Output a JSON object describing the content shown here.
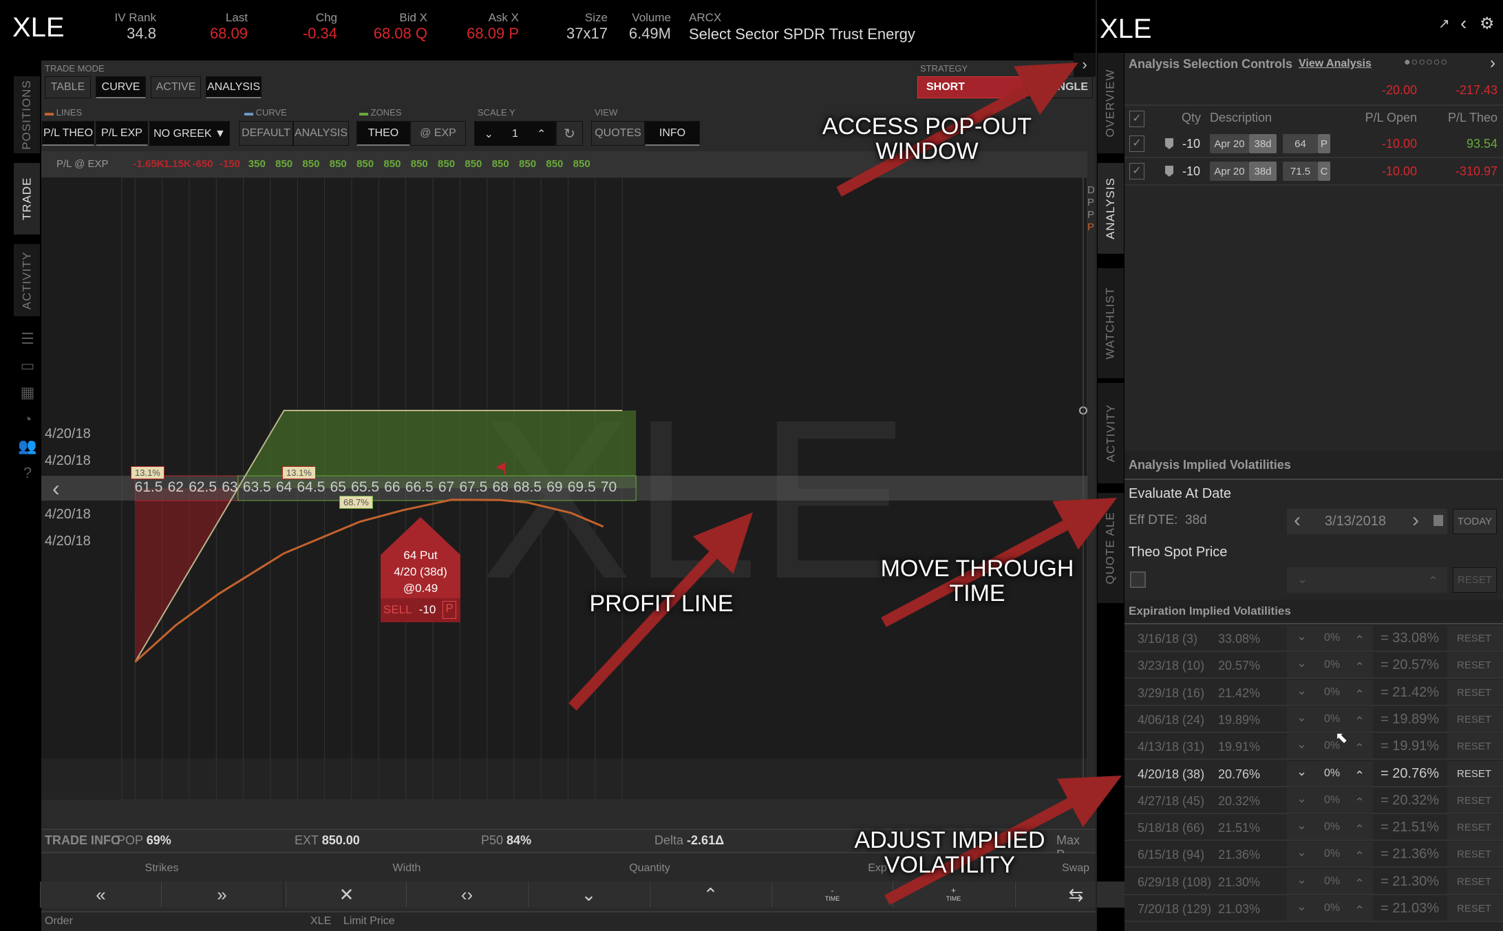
{
  "header": {
    "symbol": "XLE",
    "fields": [
      {
        "label": "IV Rank",
        "value": "34.8",
        "color": "#cccccc"
      },
      {
        "label": "Last",
        "value": "68.09",
        "color": "#d9262c"
      },
      {
        "label": "Chg",
        "value": "-0.34",
        "color": "#d9262c"
      },
      {
        "label": "Bid X",
        "value": "68.08 Q",
        "color": "#d9262c"
      },
      {
        "label": "Ask X",
        "value": "68.09 P",
        "color": "#d9262c"
      },
      {
        "label": "Size",
        "value": "37x17",
        "color": "#cccccc"
      },
      {
        "label": "Volume",
        "value": "6.49M",
        "color": "#cccccc"
      }
    ],
    "exchange": "ARCX",
    "description": "Select Sector SPDR Trust Energy"
  },
  "left_tabs": [
    "POSITIONS",
    "TRADE",
    "ACTIVITY"
  ],
  "left_icons": [
    "list-icon",
    "tv-icon",
    "calendar-icon",
    "gauge-icon",
    "people-icon",
    "help-icon"
  ],
  "trade_mode": {
    "label": "TRADE MODE",
    "tabs": [
      "TABLE",
      "CURVE",
      "ACTIVE",
      "ANALYSIS"
    ],
    "strategy_label": "STRATEGY",
    "strategy_value": "SHORT",
    "strategy_suffix": "NGLE"
  },
  "toolbar": {
    "lines": {
      "label": "LINES",
      "buttons": [
        "P/L THEO",
        "P/L EXP"
      ],
      "greek": "NO GREEK"
    },
    "curve": {
      "label": "CURVE",
      "buttons": [
        "DEFAULT",
        "ANALYSIS"
      ]
    },
    "zones": {
      "label": "ZONES",
      "buttons": [
        "THEO",
        "@ EXP"
      ]
    },
    "scale_y": {
      "label": "SCALE Y",
      "value": "1"
    },
    "view": {
      "label": "VIEW",
      "buttons": [
        "QUOTES",
        "INFO"
      ]
    }
  },
  "pl_exp": {
    "label": "P/L @ EXP",
    "values": [
      "-1.65K",
      "-1.15K",
      "-650",
      "-150",
      "350",
      "850",
      "850",
      "850",
      "850",
      "850",
      "850",
      "850",
      "850",
      "850",
      "850",
      "850",
      "850"
    ]
  },
  "chart_data": {
    "type": "line",
    "watermark": "XLE",
    "strikes": [
      "61.5",
      "62",
      "62.5",
      "63",
      "63.5",
      "64",
      "64.5",
      "65",
      "65.5",
      "66",
      "66.5",
      "67",
      "67.5",
      "68",
      "68.5",
      "69",
      "69.5",
      "70"
    ],
    "date_labels": [
      "4/20/18",
      "4/20/18",
      "4/20/18",
      "4/20/18"
    ],
    "zone_labels": {
      "left": "13.1%",
      "mid": "13.1%",
      "profit": "68.7%"
    },
    "legend": [
      "D",
      "P",
      "P",
      "P"
    ],
    "series": [
      {
        "name": "P/L EXP",
        "color": "#b9b48a",
        "points": [
          [
            61.25,
            -1900
          ],
          [
            64,
            850
          ],
          [
            70.25,
            850
          ]
        ]
      },
      {
        "name": "P/L THEO",
        "color": "#c4622d",
        "points": [
          [
            61.25,
            -1900
          ],
          [
            62,
            -1500
          ],
          [
            62.8,
            -1154
          ],
          [
            64,
            -713
          ],
          [
            65.4,
            -367
          ],
          [
            66.2,
            -240
          ],
          [
            67.1,
            -126
          ],
          [
            68,
            -130
          ],
          [
            68.5,
            -157
          ],
          [
            69.3,
            -270
          ],
          [
            69.9,
            -420
          ]
        ]
      }
    ],
    "breakeven": 63.15,
    "max_profit": 850,
    "last_price": 68.09
  },
  "order_bubble": {
    "line1": "64 Put",
    "line2": "4/20 (38d)",
    "line3": "@0.49",
    "side": "SELL",
    "qty": "-10",
    "type": "P"
  },
  "trade_info": {
    "label": "TRADE INFO",
    "pop_label": "POP",
    "pop": "69%",
    "ext_label": "EXT",
    "ext": "850.00",
    "p50_label": "P50",
    "p50": "84%",
    "delta_label": "Delta",
    "delta": "-2.61Δ",
    "maxp": "Max P"
  },
  "controls": {
    "labels": [
      "Strikes",
      "Width",
      "Quantity",
      "Exp",
      "Swap"
    ],
    "time": "TIME"
  },
  "order": {
    "label": "Order",
    "symbol": "XLE",
    "limit": "Limit Price"
  },
  "right": {
    "symbol": "XLE",
    "tabs": [
      "OVERVIEW",
      "ANALYSIS",
      "WATCHLIST",
      "ACTIVITY",
      "QUOTE ALE"
    ],
    "asc_title": "Analysis Selection Controls",
    "view_analysis": "View Analysis",
    "total_open": "-20.00",
    "total_theo": "-217.43",
    "headers": {
      "qty": "Qty",
      "desc": "Description",
      "pl_open": "P/L Open",
      "pl_theo": "P/L Theo"
    },
    "positions": [
      {
        "qty": "-10",
        "exp": "Apr 20",
        "dte": "38d",
        "strike": "64",
        "type": "P",
        "pl_open": "-10.00",
        "pl_theo": "93.54",
        "theo_color": "#6aaa3a"
      },
      {
        "qty": "-10",
        "exp": "Apr 20",
        "dte": "38d",
        "strike": "71.5",
        "type": "C",
        "pl_open": "-10.00",
        "pl_theo": "-310.97",
        "theo_color": "#d9262c"
      }
    ],
    "aiv_title": "Analysis Implied Volatilities",
    "eval_label": "Evaluate At Date",
    "eff_dte": "Eff DTE:  38d",
    "eval_date": "3/13/2018",
    "today": "TODAY",
    "spot_label": "Theo Spot Price",
    "reset": "RESET",
    "eiv_title": "Expiration Implied Volatilities",
    "iv_rows": [
      {
        "exp": "3/16/18 (3)",
        "iv": "33.08%",
        "adj": "0%",
        "result": "= 33.08%"
      },
      {
        "exp": "3/23/18 (10)",
        "iv": "20.57%",
        "adj": "0%",
        "result": "= 20.57%"
      },
      {
        "exp": "3/29/18 (16)",
        "iv": "21.42%",
        "adj": "0%",
        "result": "= 21.42%"
      },
      {
        "exp": "4/06/18 (24)",
        "iv": "19.89%",
        "adj": "0%",
        "result": "= 19.89%"
      },
      {
        "exp": "4/13/18 (31)",
        "iv": "19.91%",
        "adj": "0%",
        "result": "= 19.91%"
      },
      {
        "exp": "4/20/18 (38)",
        "iv": "20.76%",
        "adj": "0%",
        "result": "= 20.76%",
        "selected": true
      },
      {
        "exp": "4/27/18 (45)",
        "iv": "20.32%",
        "adj": "0%",
        "result": "= 20.32%"
      },
      {
        "exp": "5/18/18 (66)",
        "iv": "21.51%",
        "adj": "0%",
        "result": "= 21.51%"
      },
      {
        "exp": "6/15/18 (94)",
        "iv": "21.36%",
        "adj": "0%",
        "result": "= 21.36%"
      },
      {
        "exp": "6/29/18 (108)",
        "iv": "21.30%",
        "adj": "0%",
        "result": "= 21.30%"
      },
      {
        "exp": "7/20/18 (129)",
        "iv": "21.03%",
        "adj": "0%",
        "result": "= 21.03%"
      }
    ]
  },
  "annotations": {
    "popout": "ACCESS POP-OUT\nWINDOW",
    "profit": "PROFIT LINE",
    "time": "MOVE THROUGH\nTIME",
    "iv": "ADJUST IMPLIED\nVOLATILITY",
    "color": "#9b2424"
  }
}
